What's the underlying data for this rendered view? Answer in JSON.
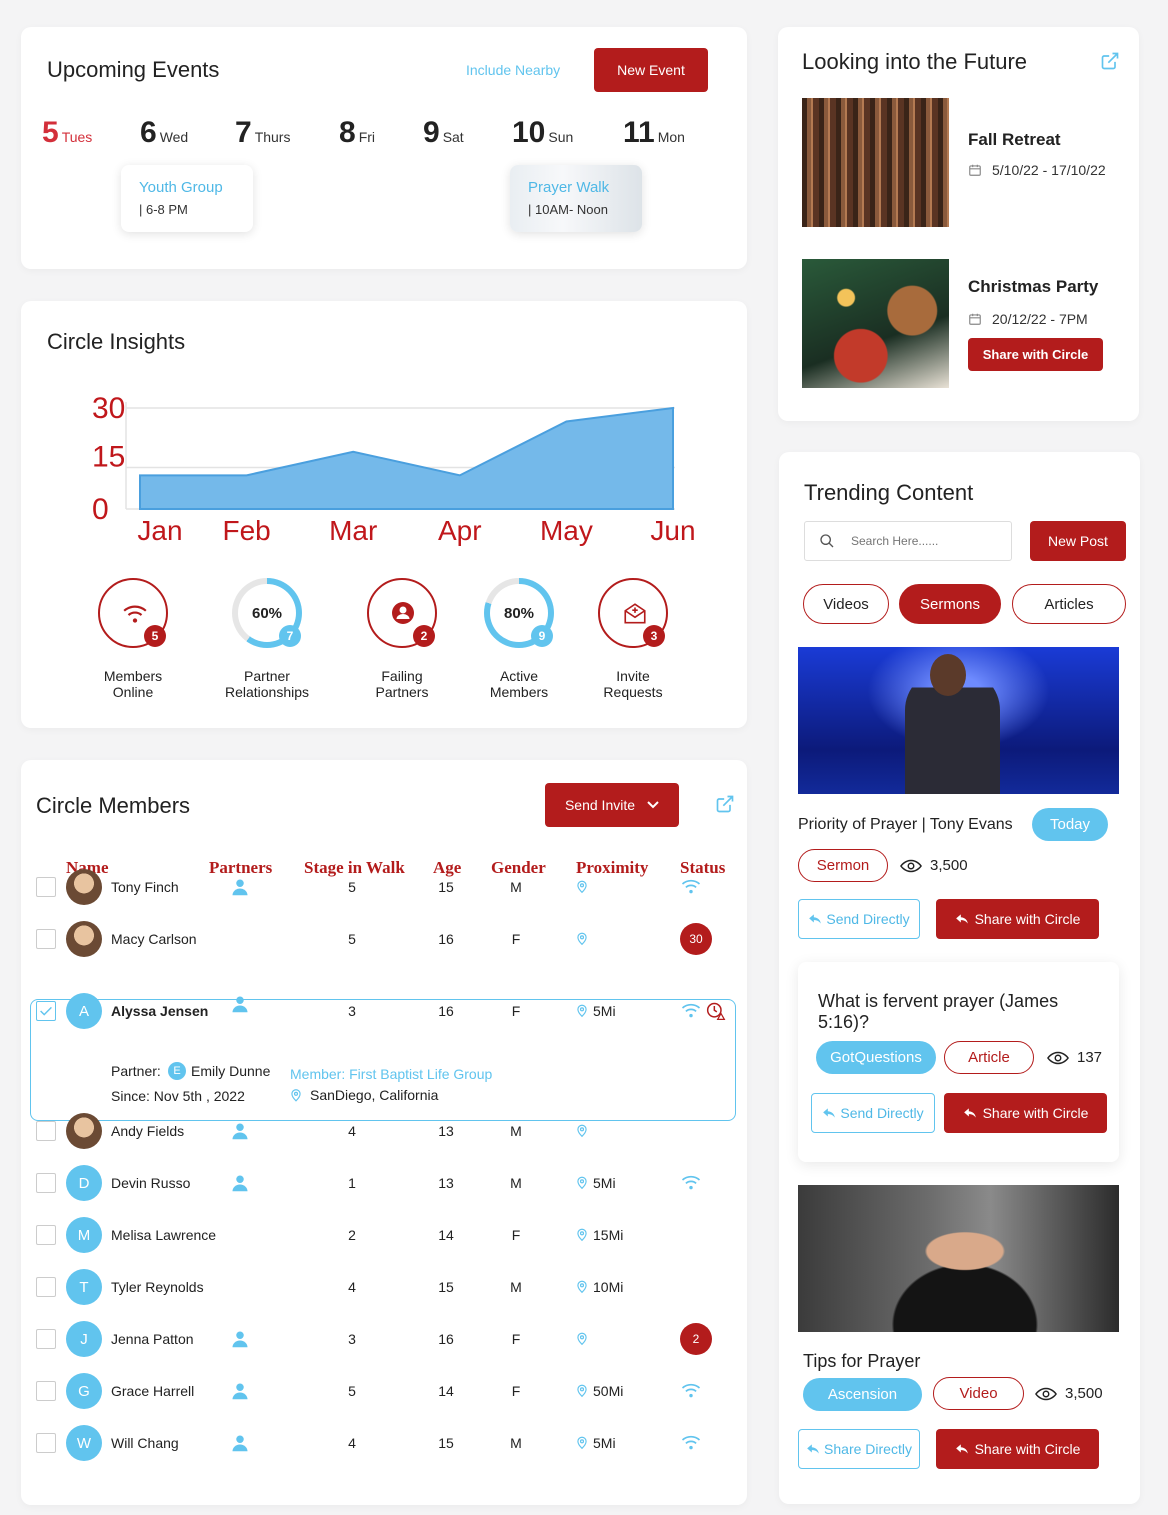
{
  "events": {
    "title": "Upcoming Events",
    "include_nearby": "Include Nearby",
    "new_event": "New Event",
    "days": [
      {
        "num": "5",
        "name": "Tues"
      },
      {
        "num": "6",
        "name": "Wed"
      },
      {
        "num": "7",
        "name": "Thurs"
      },
      {
        "num": "8",
        "name": "Fri"
      },
      {
        "num": "9",
        "name": "Sat"
      },
      {
        "num": "10",
        "name": "Sun"
      },
      {
        "num": "11",
        "name": "Mon"
      }
    ],
    "items": [
      {
        "title": "Youth Group",
        "time": "| 6-8 PM"
      },
      {
        "title": "Prayer Walk",
        "time": "| 10AM- Noon"
      }
    ]
  },
  "insights": {
    "title": "Circle Insights",
    "stats": [
      {
        "label_1": "Members",
        "label_2": "Online",
        "badge": "5",
        "icon": "wifi-icon"
      },
      {
        "label_1": "Partner",
        "label_2": "Relationships",
        "badge": "7",
        "percent": "60%",
        "fill": 0.6
      },
      {
        "label_1": "Failing",
        "label_2": "Partners",
        "badge": "2",
        "icon": "user-icon"
      },
      {
        "label_1": "Active",
        "label_2": "Members",
        "badge": "9",
        "percent": "80%",
        "fill": 0.8
      },
      {
        "label_1": "Invite",
        "label_2": "Requests",
        "badge": "3",
        "icon": "mail-icon"
      }
    ]
  },
  "chart_data": {
    "type": "area",
    "categories": [
      "Jan",
      "Feb",
      "Mar",
      "Apr",
      "May",
      "Jun"
    ],
    "values": [
      10,
      10,
      17,
      10,
      26,
      30
    ],
    "y_ticks": [
      "30",
      "15",
      "0"
    ],
    "ylim": [
      0,
      30
    ],
    "color": "#74b9ea",
    "grid": "horizontal"
  },
  "members": {
    "title": "Circle Members",
    "send_invite": "Send Invite",
    "headers": [
      "Name",
      "Partners",
      "Stage in Walk",
      "Age",
      "Gender",
      "Proximity",
      "Status"
    ],
    "rows": [
      {
        "initial": "",
        "name": "Tony Finch",
        "partner": true,
        "stage": "5",
        "age": "15",
        "gender": "M",
        "prox": "",
        "status": "wifi"
      },
      {
        "initial": "",
        "name": "Macy Carlson",
        "partner": false,
        "stage": "5",
        "age": "16",
        "gender": "F",
        "prox": "",
        "status": "30"
      },
      {
        "initial": "A",
        "name": "Alyssa Jensen",
        "partner": true,
        "stage": "3",
        "age": "16",
        "gender": "F",
        "prox": "5Mi",
        "status": "wifi-alert"
      },
      {
        "initial": "",
        "name": "Andy Fields",
        "partner": true,
        "stage": "4",
        "age": "13",
        "gender": "M",
        "prox": "",
        "status": ""
      },
      {
        "initial": "D",
        "name": "Devin Russo",
        "partner": true,
        "stage": "1",
        "age": "13",
        "gender": "M",
        "prox": "5Mi",
        "status": "wifi"
      },
      {
        "initial": "M",
        "name": "Melisa Lawrence",
        "partner": false,
        "stage": "2",
        "age": "14",
        "gender": "F",
        "prox": "15Mi",
        "status": ""
      },
      {
        "initial": "T",
        "name": "Tyler Reynolds",
        "partner": false,
        "stage": "4",
        "age": "15",
        "gender": "M",
        "prox": "10Mi",
        "status": ""
      },
      {
        "initial": "J",
        "name": "Jenna Patton",
        "partner": true,
        "stage": "3",
        "age": "16",
        "gender": "F",
        "prox": "",
        "status": "2"
      },
      {
        "initial": "G",
        "name": "Grace Harrell",
        "partner": true,
        "stage": "5",
        "age": "14",
        "gender": "F",
        "prox": "50Mi",
        "status": "wifi"
      },
      {
        "initial": "W",
        "name": "Will Chang",
        "partner": true,
        "stage": "4",
        "age": "15",
        "gender": "M",
        "prox": "5Mi",
        "status": "wifi"
      }
    ],
    "expanded": {
      "partner_label": "Partner:",
      "partner_initial": "E",
      "partner_name": "Emily Dunne",
      "since": "Since: Nov 5th , 2022",
      "member_of": "Member: First Baptist Life Group",
      "location": "SanDiego, California"
    }
  },
  "future": {
    "title": "Looking into the Future",
    "items": [
      {
        "title": "Fall Retreat",
        "date": "5/10/22 - 17/10/22"
      },
      {
        "title": "Christmas Party",
        "date": "20/12/22 - 7PM",
        "button": "Share with Circle"
      }
    ]
  },
  "trending": {
    "title": "Trending Content",
    "search_placeholder": "Search Here......",
    "new_post": "New Post",
    "filters": [
      "Videos",
      "Sermons",
      "Articles"
    ],
    "active_filter": "Sermons",
    "items": [
      {
        "title": "Priority of Prayer | Tony Evans",
        "tag": "Today",
        "type": "Sermon",
        "views": "3,500",
        "send": "Send Directly",
        "share": "Share with Circle"
      },
      {
        "title": "What is fervent prayer (James 5:16)?",
        "tag": "GotQuestions",
        "type": "Article",
        "views": "137",
        "send": "Send Directly",
        "share": "Share with Circle"
      },
      {
        "title": "Tips for Prayer",
        "tag": "Ascension",
        "type": "Video",
        "views": "3,500",
        "send": "Share Directly",
        "share": "Share with Circle"
      }
    ]
  }
}
